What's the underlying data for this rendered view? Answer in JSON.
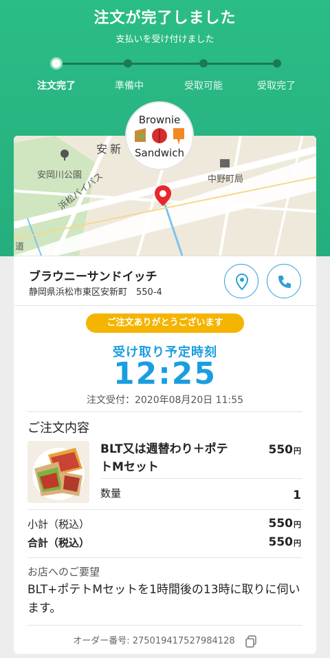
{
  "header": {
    "title": "注文が完了しました",
    "subtitle": "支払いを受け付けました",
    "steps": [
      {
        "label": "注文完了",
        "active": true
      },
      {
        "label": "準備中",
        "active": false
      },
      {
        "label": "受取可能",
        "active": false
      },
      {
        "label": "受取完了",
        "active": false
      }
    ]
  },
  "map": {
    "labels": {
      "area": "安新",
      "park": "安岡川公園",
      "bypass": "浜松バイパス",
      "post": "中野町局",
      "road": "道"
    }
  },
  "logo": {
    "top": "Brownie",
    "bottom": "Sandwich"
  },
  "shop": {
    "name": "ブラウニーサンドイッチ",
    "address": "静岡県浜松市東区安新町　550-4",
    "map_button_icon": "map-pin-icon",
    "phone_button_icon": "phone-icon"
  },
  "status": {
    "thanks": "ご注文ありがとうございます",
    "pickup_label": "受け取り予定時刻",
    "pickup_time": "12:25",
    "order_received": "注文受付：2020年08月20日 11:55"
  },
  "order": {
    "section_title": "ご注文内容",
    "item": {
      "name": "BLT又は週替わり＋ポテトMセット",
      "price": "550",
      "price_unit": "円",
      "qty_label": "数量",
      "qty": "1"
    },
    "subtotal_label": "小計（税込）",
    "subtotal": "550",
    "total_label": "合計（税込）",
    "total": "550",
    "currency": "円"
  },
  "request": {
    "label": "お店へのご要望",
    "text": "BLT+ポテトMセットを1時間後の13時に取りに伺います。"
  },
  "footer": {
    "order_number": "オーダー番号: 275019417527984128",
    "copy_icon": "copy-icon"
  },
  "colors": {
    "header_green": "#2bbd86",
    "accent_blue": "#1a9ee0",
    "badge_yellow": "#f4b400"
  }
}
